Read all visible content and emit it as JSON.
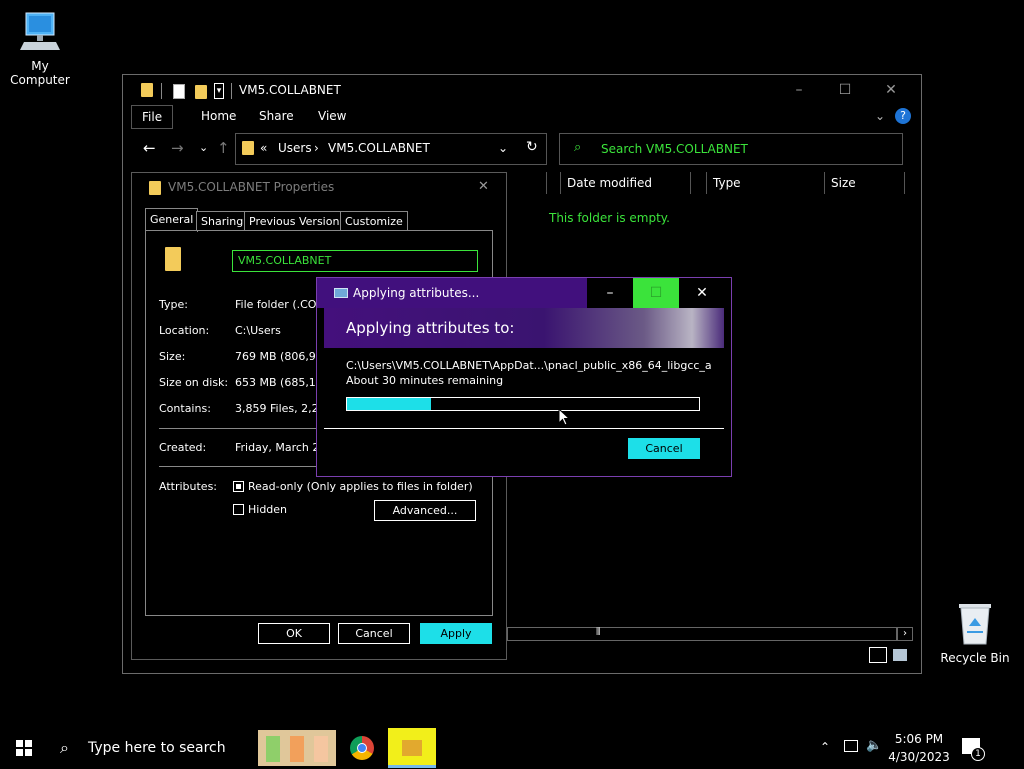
{
  "desktop": {
    "my_computer_label": "My Computer",
    "recycle_bin_label": "Recycle Bin"
  },
  "explorer": {
    "title": "VM5.COLLABNET",
    "ribbon_tabs": [
      "File",
      "Home",
      "Share",
      "View"
    ],
    "breadcrumb": {
      "prefix": "«",
      "part1": "Users",
      "sep": "›",
      "part2": "VM5.COLLABNET"
    },
    "search_placeholder": "Search VM5.COLLABNET",
    "columns": [
      "Date modified",
      "Type",
      "Size"
    ],
    "empty_message": "This folder is empty."
  },
  "properties": {
    "title": "VM5.COLLABNET Properties",
    "tabs": [
      "General",
      "Sharing",
      "Previous Versions",
      "Customize"
    ],
    "name_value": "VM5.COLLABNET",
    "rows": [
      {
        "label": "Type:",
        "value": "File folder (.COLL"
      },
      {
        "label": "Location:",
        "value": "C:\\Users"
      },
      {
        "label": "Size:",
        "value": "769 MB (806,931"
      },
      {
        "label": "Size on disk:",
        "value": "653 MB (685,121"
      },
      {
        "label": "Contains:",
        "value": "3,859 Files, 2,21"
      },
      {
        "label": "Created:",
        "value": "Friday, March 24"
      }
    ],
    "attributes_label": "Attributes:",
    "readonly_label": "Read-only (Only applies to files in folder)",
    "hidden_label": "Hidden",
    "advanced_label": "Advanced...",
    "ok_label": "OK",
    "cancel_label": "Cancel",
    "apply_label": "Apply"
  },
  "apply_dialog": {
    "title": "Applying attributes...",
    "heading": "Applying attributes to:",
    "path": "C:\\Users\\VM5.COLLABNET\\AppDat...\\pnacl_public_x86_64_libgcc_a",
    "remaining": "About 30 minutes remaining",
    "progress": 0.24,
    "cancel_label": "Cancel"
  },
  "taskbar": {
    "search_placeholder": "Type here to search",
    "time": "5:06 PM",
    "date": "4/30/2023",
    "notification_count": "1"
  },
  "colors": {
    "accent_cyan": "#1ddfe8",
    "accent_green": "#3be33b",
    "dialog_purple": "#41107d"
  }
}
